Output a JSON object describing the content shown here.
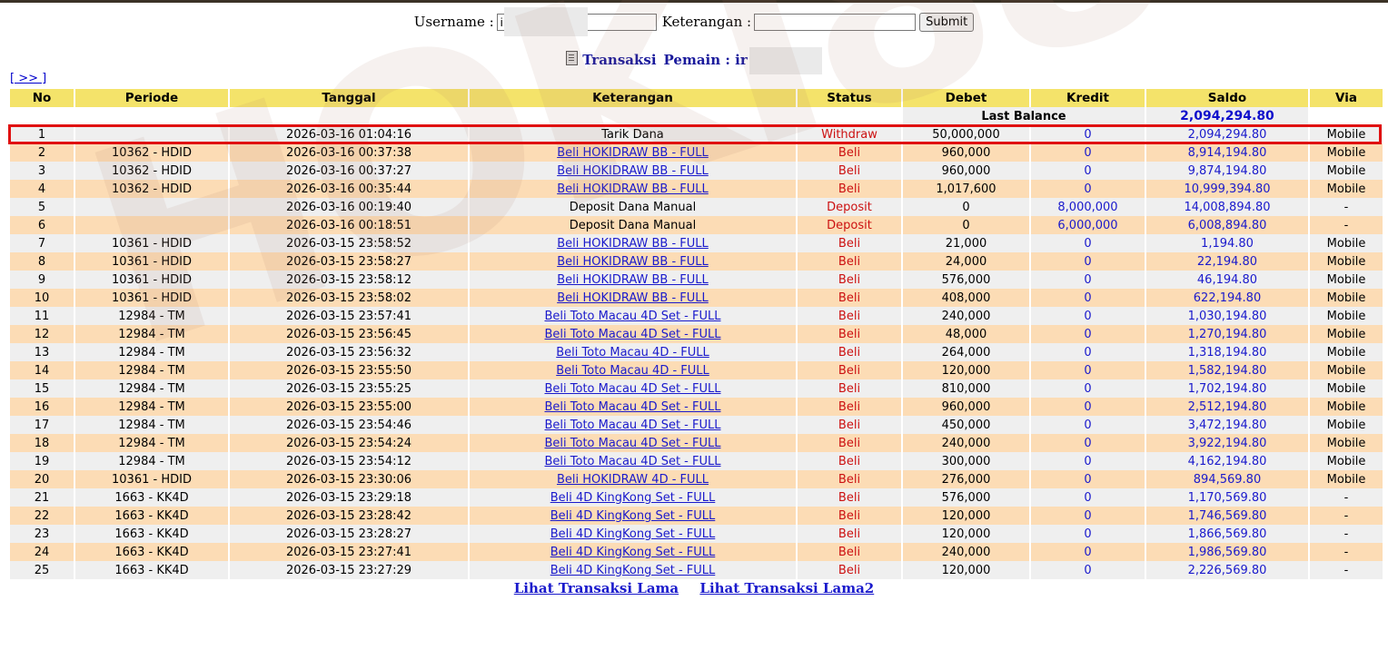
{
  "form": {
    "username_label": "Username :",
    "username_value": "i",
    "keterangan_label": "Keterangan :",
    "keterangan_value": "",
    "submit_label": "Submit"
  },
  "heading": {
    "title": "Transaksi",
    "player_label": "Pemain : ir"
  },
  "nav_next": "[ >> ]",
  "columns": [
    "No",
    "Periode",
    "Tanggal",
    "Keterangan",
    "Status",
    "Debet",
    "Kredit",
    "Saldo",
    "Via"
  ],
  "last_balance": {
    "label": "Last Balance",
    "value": "2,094,294.80"
  },
  "rows": [
    {
      "no": "1",
      "periode": "",
      "tanggal": "2026-03-16 01:04:16",
      "ket": "Tarik Dana",
      "link": false,
      "status": "Withdraw",
      "debet": "50,000,000",
      "kredit": "0",
      "saldo": "2,094,294.80",
      "via": "Mobile"
    },
    {
      "no": "2",
      "periode": "10362 - HDID",
      "tanggal": "2026-03-16 00:37:38",
      "ket": "Beli HOKIDRAW BB - FULL",
      "link": true,
      "status": "Beli",
      "debet": "960,000",
      "kredit": "0",
      "saldo": "8,914,194.80",
      "via": "Mobile"
    },
    {
      "no": "3",
      "periode": "10362 - HDID",
      "tanggal": "2026-03-16 00:37:27",
      "ket": "Beli HOKIDRAW BB - FULL",
      "link": true,
      "status": "Beli",
      "debet": "960,000",
      "kredit": "0",
      "saldo": "9,874,194.80",
      "via": "Mobile"
    },
    {
      "no": "4",
      "periode": "10362 - HDID",
      "tanggal": "2026-03-16 00:35:44",
      "ket": "Beli HOKIDRAW BB - FULL",
      "link": true,
      "status": "Beli",
      "debet": "1,017,600",
      "kredit": "0",
      "saldo": "10,999,394.80",
      "via": "Mobile"
    },
    {
      "no": "5",
      "periode": "",
      "tanggal": "2026-03-16 00:19:40",
      "ket": "Deposit Dana Manual",
      "link": false,
      "status": "Deposit",
      "debet": "0",
      "kredit": "8,000,000",
      "saldo": "14,008,894.80",
      "via": "-"
    },
    {
      "no": "6",
      "periode": "",
      "tanggal": "2026-03-16 00:18:51",
      "ket": "Deposit Dana Manual",
      "link": false,
      "status": "Deposit",
      "debet": "0",
      "kredit": "6,000,000",
      "saldo": "6,008,894.80",
      "via": "-"
    },
    {
      "no": "7",
      "periode": "10361 - HDID",
      "tanggal": "2026-03-15 23:58:52",
      "ket": "Beli HOKIDRAW BB - FULL",
      "link": true,
      "status": "Beli",
      "debet": "21,000",
      "kredit": "0",
      "saldo": "1,194.80",
      "via": "Mobile"
    },
    {
      "no": "8",
      "periode": "10361 - HDID",
      "tanggal": "2026-03-15 23:58:27",
      "ket": "Beli HOKIDRAW BB - FULL",
      "link": true,
      "status": "Beli",
      "debet": "24,000",
      "kredit": "0",
      "saldo": "22,194.80",
      "via": "Mobile"
    },
    {
      "no": "9",
      "periode": "10361 - HDID",
      "tanggal": "2026-03-15 23:58:12",
      "ket": "Beli HOKIDRAW BB - FULL",
      "link": true,
      "status": "Beli",
      "debet": "576,000",
      "kredit": "0",
      "saldo": "46,194.80",
      "via": "Mobile"
    },
    {
      "no": "10",
      "periode": "10361 - HDID",
      "tanggal": "2026-03-15 23:58:02",
      "ket": "Beli HOKIDRAW BB - FULL",
      "link": true,
      "status": "Beli",
      "debet": "408,000",
      "kredit": "0",
      "saldo": "622,194.80",
      "via": "Mobile"
    },
    {
      "no": "11",
      "periode": "12984 - TM",
      "tanggal": "2026-03-15 23:57:41",
      "ket": "Beli Toto Macau 4D Set - FULL",
      "link": true,
      "status": "Beli",
      "debet": "240,000",
      "kredit": "0",
      "saldo": "1,030,194.80",
      "via": "Mobile"
    },
    {
      "no": "12",
      "periode": "12984 - TM",
      "tanggal": "2026-03-15 23:56:45",
      "ket": "Beli Toto Macau 4D Set - FULL",
      "link": true,
      "status": "Beli",
      "debet": "48,000",
      "kredit": "0",
      "saldo": "1,270,194.80",
      "via": "Mobile"
    },
    {
      "no": "13",
      "periode": "12984 - TM",
      "tanggal": "2026-03-15 23:56:32",
      "ket": "Beli Toto Macau 4D - FULL",
      "link": true,
      "status": "Beli",
      "debet": "264,000",
      "kredit": "0",
      "saldo": "1,318,194.80",
      "via": "Mobile"
    },
    {
      "no": "14",
      "periode": "12984 - TM",
      "tanggal": "2026-03-15 23:55:50",
      "ket": "Beli Toto Macau 4D - FULL",
      "link": true,
      "status": "Beli",
      "debet": "120,000",
      "kredit": "0",
      "saldo": "1,582,194.80",
      "via": "Mobile"
    },
    {
      "no": "15",
      "periode": "12984 - TM",
      "tanggal": "2026-03-15 23:55:25",
      "ket": "Beli Toto Macau 4D Set - FULL",
      "link": true,
      "status": "Beli",
      "debet": "810,000",
      "kredit": "0",
      "saldo": "1,702,194.80",
      "via": "Mobile"
    },
    {
      "no": "16",
      "periode": "12984 - TM",
      "tanggal": "2026-03-15 23:55:00",
      "ket": "Beli Toto Macau 4D Set - FULL",
      "link": true,
      "status": "Beli",
      "debet": "960,000",
      "kredit": "0",
      "saldo": "2,512,194.80",
      "via": "Mobile"
    },
    {
      "no": "17",
      "periode": "12984 - TM",
      "tanggal": "2026-03-15 23:54:46",
      "ket": "Beli Toto Macau 4D Set - FULL",
      "link": true,
      "status": "Beli",
      "debet": "450,000",
      "kredit": "0",
      "saldo": "3,472,194.80",
      "via": "Mobile"
    },
    {
      "no": "18",
      "periode": "12984 - TM",
      "tanggal": "2026-03-15 23:54:24",
      "ket": "Beli Toto Macau 4D Set - FULL",
      "link": true,
      "status": "Beli",
      "debet": "240,000",
      "kredit": "0",
      "saldo": "3,922,194.80",
      "via": "Mobile"
    },
    {
      "no": "19",
      "periode": "12984 - TM",
      "tanggal": "2026-03-15 23:54:12",
      "ket": "Beli Toto Macau 4D Set - FULL",
      "link": true,
      "status": "Beli",
      "debet": "300,000",
      "kredit": "0",
      "saldo": "4,162,194.80",
      "via": "Mobile"
    },
    {
      "no": "20",
      "periode": "10361 - HDID",
      "tanggal": "2026-03-15 23:30:06",
      "ket": "Beli HOKIDRAW 4D - FULL",
      "link": true,
      "status": "Beli",
      "debet": "276,000",
      "kredit": "0",
      "saldo": "894,569.80",
      "via": "Mobile"
    },
    {
      "no": "21",
      "periode": "1663 - KK4D",
      "tanggal": "2026-03-15 23:29:18",
      "ket": "Beli 4D KingKong Set - FULL",
      "link": true,
      "status": "Beli",
      "debet": "576,000",
      "kredit": "0",
      "saldo": "1,170,569.80",
      "via": "-"
    },
    {
      "no": "22",
      "periode": "1663 - KK4D",
      "tanggal": "2026-03-15 23:28:42",
      "ket": "Beli 4D KingKong Set - FULL",
      "link": true,
      "status": "Beli",
      "debet": "120,000",
      "kredit": "0",
      "saldo": "1,746,569.80",
      "via": "-"
    },
    {
      "no": "23",
      "periode": "1663 - KK4D",
      "tanggal": "2026-03-15 23:28:27",
      "ket": "Beli 4D KingKong Set - FULL",
      "link": true,
      "status": "Beli",
      "debet": "120,000",
      "kredit": "0",
      "saldo": "1,866,569.80",
      "via": "-"
    },
    {
      "no": "24",
      "periode": "1663 - KK4D",
      "tanggal": "2026-03-15 23:27:41",
      "ket": "Beli 4D KingKong Set - FULL",
      "link": true,
      "status": "Beli",
      "debet": "240,000",
      "kredit": "0",
      "saldo": "1,986,569.80",
      "via": "-"
    },
    {
      "no": "25",
      "periode": "1663 - KK4D",
      "tanggal": "2026-03-15 23:27:29",
      "ket": "Beli 4D KingKong Set - FULL",
      "link": true,
      "status": "Beli",
      "debet": "120,000",
      "kredit": "0",
      "saldo": "2,226,569.80",
      "via": "-"
    }
  ],
  "bottom_links": [
    "Lihat Transaksi Lama",
    "Lihat Transaksi Lama2"
  ],
  "colors": {
    "header_bg": "#f4e36a",
    "row_even": "#efefef",
    "row_odd": "#fcdcb5",
    "link": "#1a1acc",
    "status": "#cc1111",
    "highlight": "#e01010"
  }
}
